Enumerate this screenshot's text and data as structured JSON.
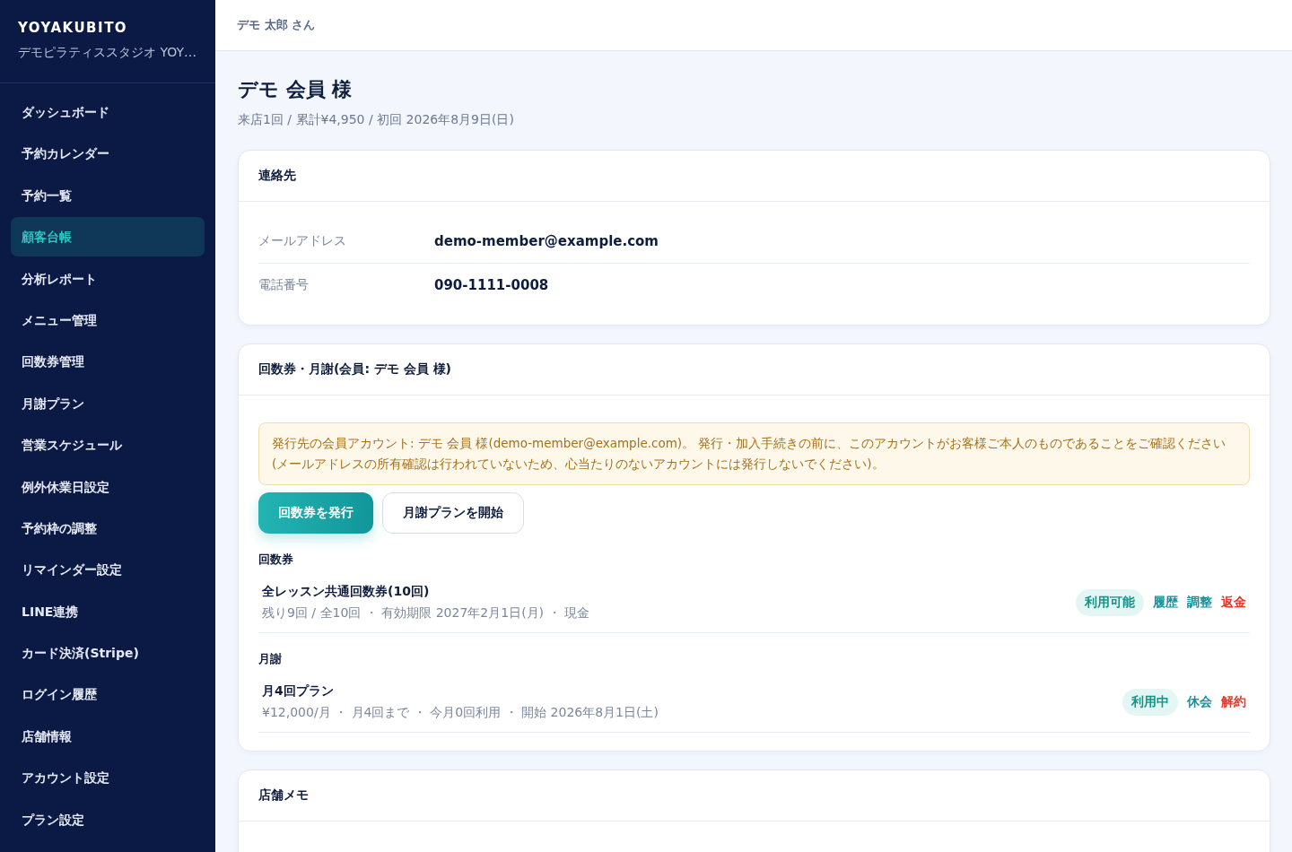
{
  "sidebar": {
    "brand": "YOYAKUBITO",
    "store": "デモピラティススタジオ YOY…",
    "items": [
      {
        "label": "ダッシュボード",
        "selected": false
      },
      {
        "label": "予約カレンダー",
        "selected": false
      },
      {
        "label": "予約一覧",
        "selected": false
      },
      {
        "label": "顧客台帳",
        "selected": true
      },
      {
        "label": "分析レポート",
        "selected": false
      },
      {
        "label": "メニュー管理",
        "selected": false
      },
      {
        "label": "回数券管理",
        "selected": false
      },
      {
        "label": "月謝プラン",
        "selected": false
      },
      {
        "label": "営業スケジュール",
        "selected": false
      },
      {
        "label": "例外休業日設定",
        "selected": false
      },
      {
        "label": "予約枠の調整",
        "selected": false
      },
      {
        "label": "リマインダー設定",
        "selected": false
      },
      {
        "label": "LINE連携",
        "selected": false
      },
      {
        "label": "カード決済(Stripe)",
        "selected": false
      },
      {
        "label": "ログイン履歴",
        "selected": false
      },
      {
        "label": "店舗情報",
        "selected": false
      },
      {
        "label": "アカウント設定",
        "selected": false
      },
      {
        "label": "プラン設定",
        "selected": false
      }
    ]
  },
  "header": {
    "user": "デモ 太郎 さん"
  },
  "page": {
    "title": "デモ 会員 様",
    "summary": "来店1回 / 累計¥4,950 / 初回 2026年8月9日(日)"
  },
  "contact": {
    "title": "連絡先",
    "fields": [
      {
        "label": "メールアドレス",
        "value": "demo-member@example.com"
      },
      {
        "label": "電話番号",
        "value": "090-1111-0008"
      }
    ]
  },
  "passes": {
    "title": "回数券・月謝(会員: デモ 会員 様)",
    "notice": "発行先の会員アカウント: デモ 会員 様(demo-member@example.com)。 発行・加入手続きの前に、このアカウントがお客様ご本人のものであることをご確認ください(メールアドレスの所有確認は行われていないため、心当たりのないアカウントには発行しないでください)。",
    "buttons": [
      {
        "label": "回数券を発行",
        "kind": "primary"
      },
      {
        "label": "月謝プランを開始",
        "kind": "secondary"
      }
    ],
    "sections": [
      {
        "heading": "回数券",
        "items": [
          {
            "name": "全レッスン共通回数券(10回)",
            "meta": "残り9回 / 全10回 ・ 有効期限 2027年2月1日(月) ・ 現金",
            "status": "利用可能",
            "actions": [
              {
                "label": "履歴",
                "kind": "link"
              },
              {
                "label": "調整",
                "kind": "link"
              },
              {
                "label": "返金",
                "kind": "danger"
              }
            ]
          }
        ]
      },
      {
        "heading": "月謝",
        "items": [
          {
            "name": "月4回プラン",
            "meta": "¥12,000/月 ・ 月4回まで ・ 今月0回利用 ・ 開始 2026年8月1日(土)",
            "status": "利用中",
            "actions": [
              {
                "label": "休会",
                "kind": "link"
              },
              {
                "label": "解約",
                "kind": "danger"
              }
            ]
          }
        ]
      }
    ]
  },
  "memo": {
    "title": "店舗メモ"
  }
}
